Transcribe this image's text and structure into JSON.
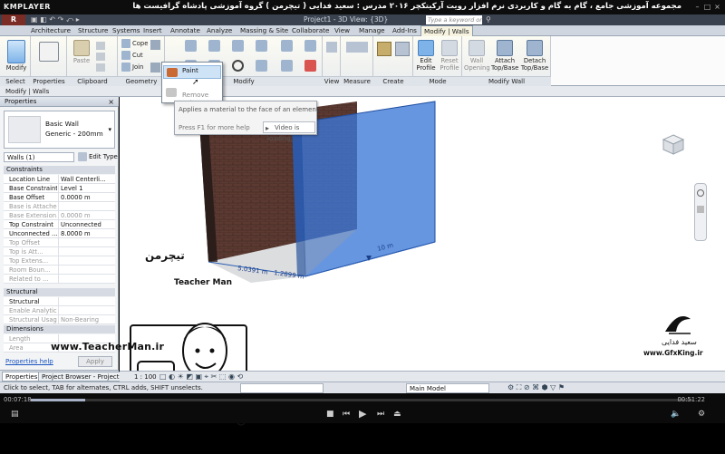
{
  "player": {
    "brand": "KMPLAYER",
    "title": "مجموعه آموزشی جامع ، گام به گام و کاربردی نرم افزار رویت آرکیتکچر ۲۰۱۶ مدرس : سعید فدایی ( تیچرمن ) گروه آموزشی پادشاه گرافیست ها",
    "time_elapsed": "00:07:18",
    "time_total": "00:51:22"
  },
  "revit": {
    "app_button": "R",
    "title": "Project1 - 3D View: {3D}",
    "search_placeholder": "Type a keyword or phrase"
  },
  "tabs": [
    "Architecture",
    "Structure",
    "Systems",
    "Insert",
    "Annotate",
    "Analyze",
    "Massing & Site",
    "Collaborate",
    "View",
    "Manage",
    "Add-Ins",
    "Modify | Walls"
  ],
  "ribbon": {
    "select": {
      "label": "Select",
      "modify": "Modify"
    },
    "properties": {
      "label": "Properties"
    },
    "clipboard": {
      "label": "Clipboard",
      "paste": "Paste"
    },
    "geometry": {
      "label": "Geometry",
      "cope": "Cope",
      "cut": "Cut",
      "join": "Join"
    },
    "modify": {
      "label": "Modify"
    },
    "view": {
      "label": "View"
    },
    "measure": {
      "label": "Measure"
    },
    "create": {
      "label": "Create"
    },
    "mode": {
      "label": "Mode",
      "edit_profile": "Edit Profile",
      "reset_profile": "Reset Profile"
    },
    "modify_wall": {
      "label": "Modify Wall",
      "wall_opening": "Wall Opening",
      "attach": "Attach Top/Base",
      "detach": "Detach Top/Base"
    }
  },
  "context_label": "Modify | Walls",
  "paint_menu": {
    "paint": "Paint",
    "remove": "Remove Paint"
  },
  "tooltip": {
    "line1": "Applies a material to the face of an element.",
    "help": "Press F1 for more help",
    "video": "Video is loading..."
  },
  "properties": {
    "header": "Properties",
    "type_line1": "Basic Wall",
    "type_line2": "Generic - 200mm",
    "selector": "Walls (1)",
    "edit_type": "Edit Type",
    "sections": {
      "constraints": "Constraints",
      "structural": "Structural",
      "dimensions": "Dimensions"
    },
    "rows": [
      {
        "name": "Location Line",
        "value": "Wall Centerli..."
      },
      {
        "name": "Base Constraint",
        "value": "Level 1"
      },
      {
        "name": "Base Offset",
        "value": "0.0000 m"
      },
      {
        "name": "Base is Attached",
        "value": ""
      },
      {
        "name": "Base Extension...",
        "value": "0.0000 m"
      },
      {
        "name": "Top Constraint",
        "value": "Unconnected"
      },
      {
        "name": "Unconnected ...",
        "value": "8.0000 m"
      },
      {
        "name": "Top Offset",
        "value": ""
      },
      {
        "name": "Top is Att...",
        "value": ""
      },
      {
        "name": "Top Extens...",
        "value": ""
      },
      {
        "name": "Room Boun...",
        "value": ""
      },
      {
        "name": "Related to ...",
        "value": ""
      }
    ],
    "struct_rows": [
      {
        "name": "Structural",
        "value": ""
      },
      {
        "name": "Enable Analytic...",
        "value": ""
      },
      {
        "name": "Structural Usage",
        "value": "Non-Bearing"
      }
    ],
    "dim_rows": [
      {
        "name": "Length",
        "value": ""
      },
      {
        "name": "Area",
        "value": ""
      }
    ],
    "help": "Properties help",
    "apply": "Apply",
    "tab_props": "Properties",
    "tab_browser": "Project Browser - Project1"
  },
  "viewport": {
    "dim1": "5.0391 m",
    "dim2": "1.2899 m",
    "dim3": "10 m",
    "scale": "1 : 100"
  },
  "status": {
    "text": "Click to select, TAB for alternates, CTRL adds, SHIFT unselects.",
    "model": "Main Model"
  },
  "watermark": {
    "site": "www.TeacherMan.ir",
    "brand_en": "Teacher Man",
    "brand_fa": "تیچرمن",
    "teacher_fa": "سعید فدایی",
    "gfx": "www.GfxKing.ir"
  }
}
